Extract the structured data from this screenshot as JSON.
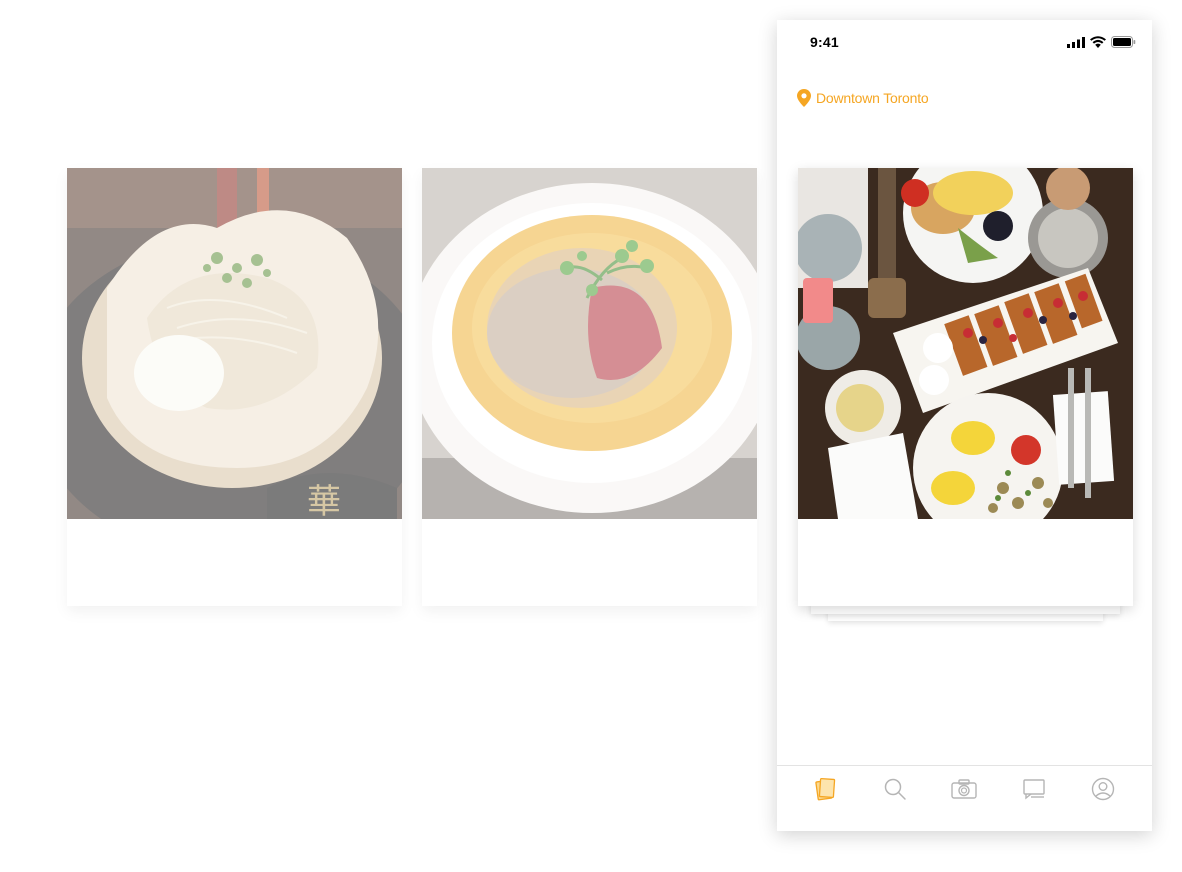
{
  "status_bar": {
    "time": "9:41",
    "icons": [
      "signal-icon",
      "wifi-icon",
      "battery-icon"
    ]
  },
  "location": {
    "label": "Downtown Toronto",
    "icon": "map-pin-icon",
    "color": "#f5a623"
  },
  "cards": [
    {
      "image": "ramen-bowl-photo"
    },
    {
      "image": "consomme-soup-photo"
    },
    {
      "image": "brunch-table-photo"
    }
  ],
  "tab_bar": {
    "active_color": "#f5a623",
    "inactive_color": "#b5b5b5",
    "tabs": [
      {
        "icon": "cards-icon",
        "active": true
      },
      {
        "icon": "search-icon",
        "active": false
      },
      {
        "icon": "camera-icon",
        "active": false
      },
      {
        "icon": "messages-icon",
        "active": false
      },
      {
        "icon": "profile-icon",
        "active": false
      }
    ]
  }
}
